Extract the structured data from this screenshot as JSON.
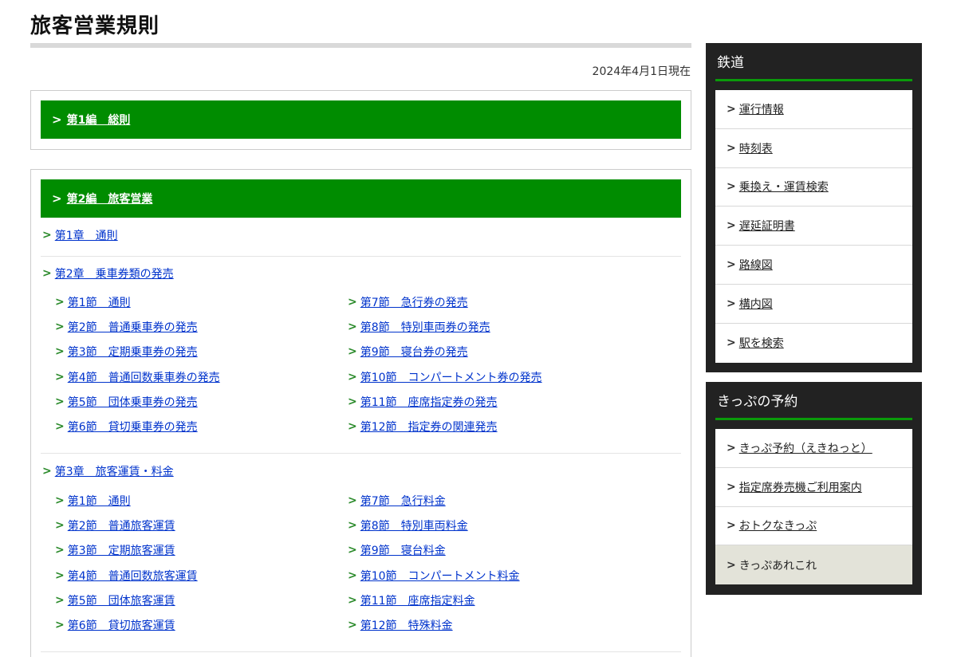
{
  "page": {
    "title": "旅客営業規則",
    "as_of": "2024年4月1日現在"
  },
  "part1": {
    "label": "第1編　総則"
  },
  "part2": {
    "label": "第2編　旅客営業",
    "chapter1": "第1章　通則",
    "chapter2": {
      "label": "第2章　乗車券類の発売",
      "left": [
        "第1節　通則",
        "第2節　普通乗車券の発売",
        "第3節　定期乗車券の発売",
        "第4節　普通回数乗車券の発売",
        "第5節　団体乗車券の発売",
        "第6節　貸切乗車券の発売"
      ],
      "right": [
        "第7節　急行券の発売",
        "第8節　特別車両券の発売",
        "第9節　寝台券の発売",
        "第10節　コンパートメント券の発売",
        "第11節　座席指定券の発売",
        "第12節　指定券の関連発売"
      ]
    },
    "chapter3": {
      "label": "第3章　旅客運賃・料金",
      "left": [
        "第1節　通則",
        "第2節　普通旅客運賃",
        "第3節　定期旅客運賃",
        "第4節　普通回数旅客運賃",
        "第5節　団体旅客運賃",
        "第6節　貸切旅客運賃"
      ],
      "right": [
        "第7節　急行料金",
        "第8節　特別車両料金",
        "第9節　寝台料金",
        "第10節　コンパートメント料金",
        "第11節　座席指定料金",
        "第12節　特殊料金"
      ]
    }
  },
  "sidebar": {
    "railway": {
      "title": "鉄道",
      "items": [
        "運行情報",
        "時刻表",
        "乗換え・運賃検索",
        "遅延証明書",
        "路線図",
        "構内図",
        "駅を検索"
      ]
    },
    "tickets": {
      "title": "きっぷの予約",
      "items": [
        "きっぷ予約（えきねっと）",
        "指定席券売機ご利用案内",
        "おトクなきっぷ",
        "きっぷあれこれ"
      ],
      "active_item": "きっぷあれこれ"
    }
  },
  "colors": {
    "accent_green": "#008c00",
    "link_blue": "#0033cc",
    "sidebar_bg": "#222222"
  }
}
